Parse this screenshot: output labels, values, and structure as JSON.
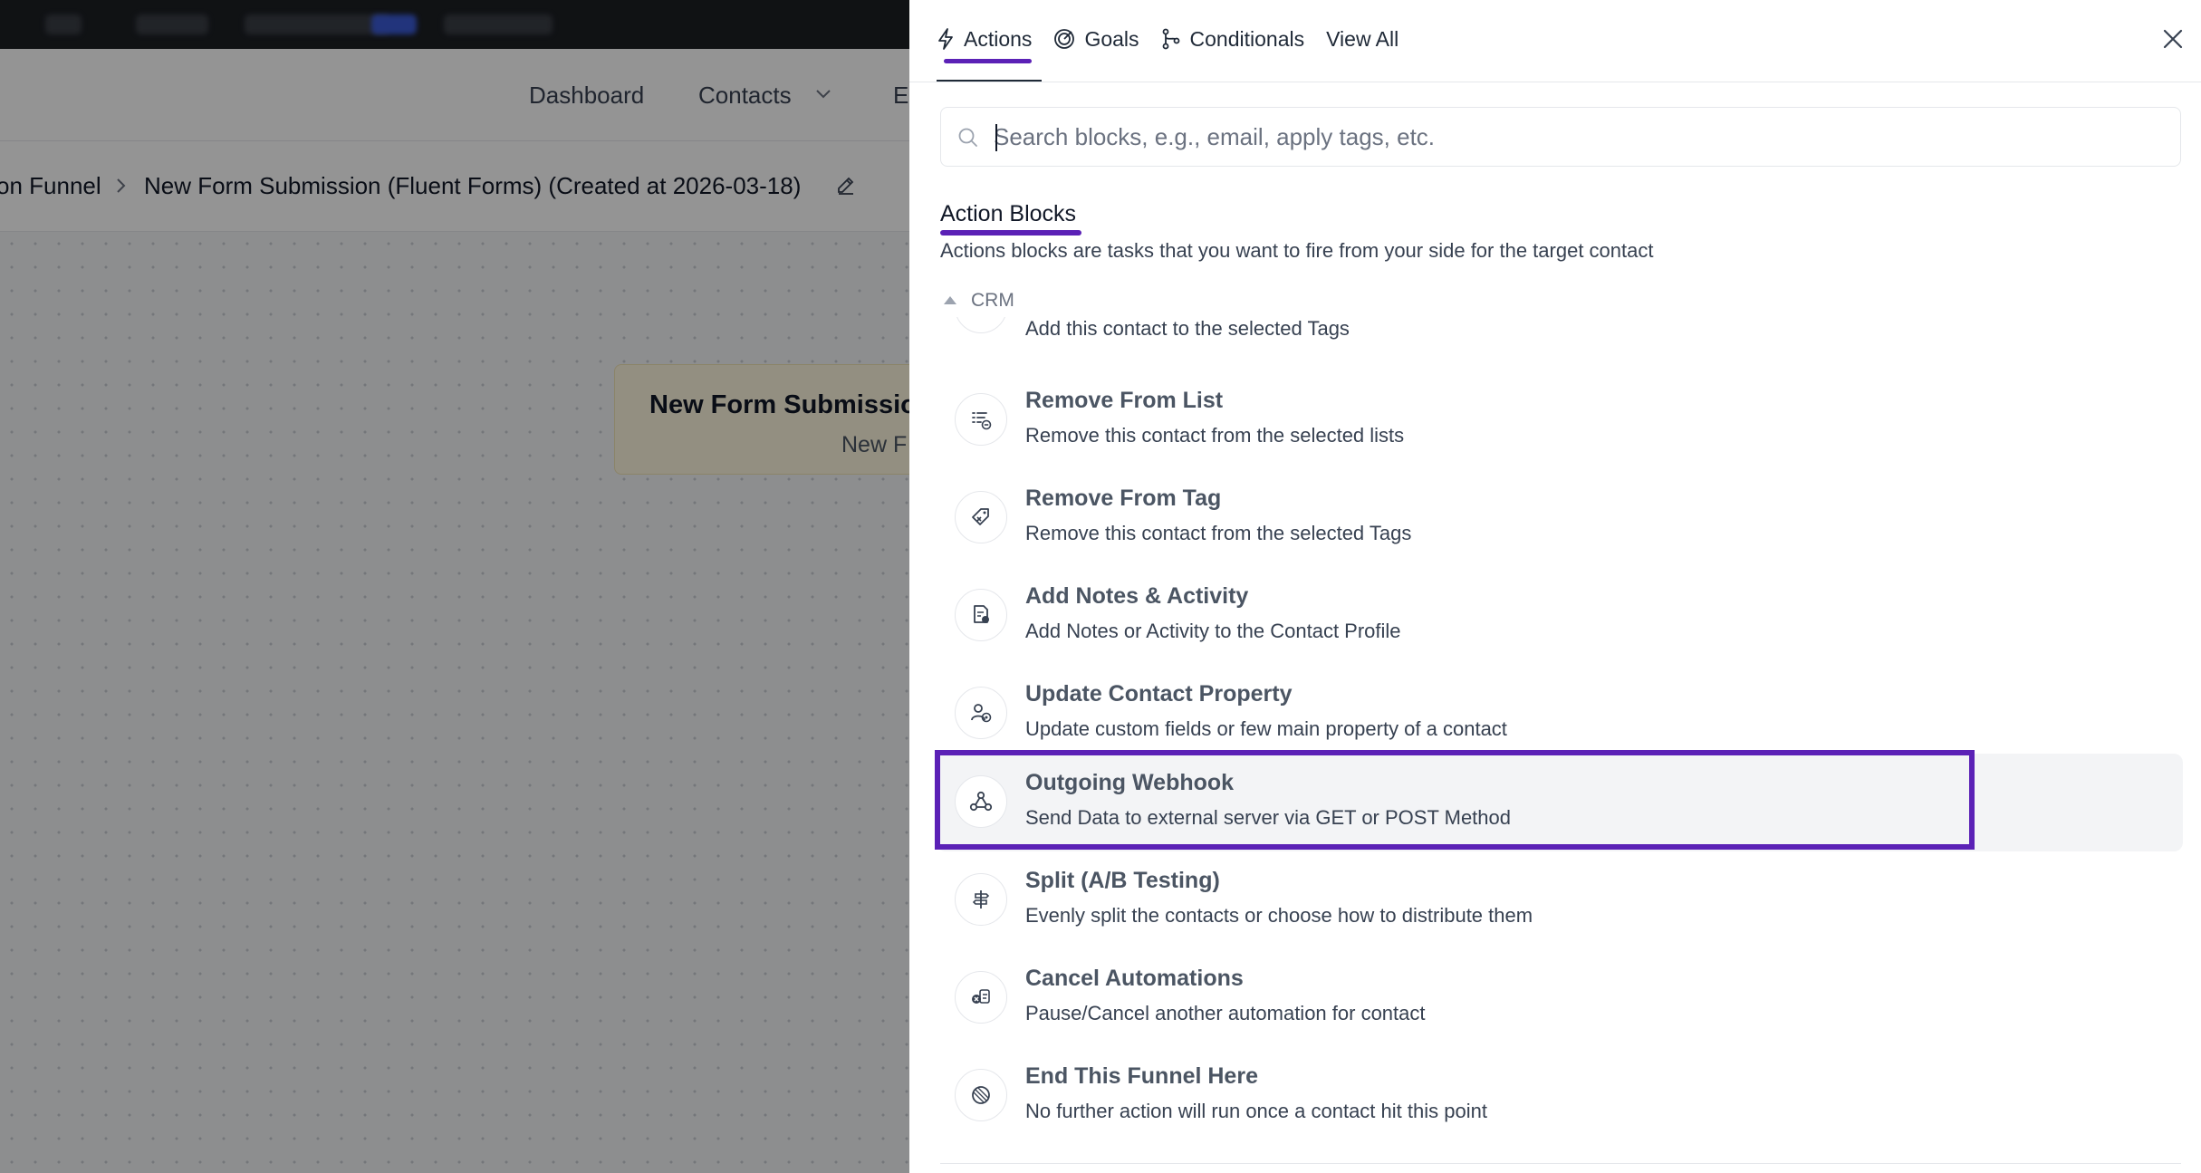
{
  "background": {
    "nav": {
      "dashboard": "Dashboard",
      "contacts": "Contacts",
      "truncated": "E"
    },
    "breadcrumb": {
      "parent": "on Funnel",
      "current": "New Form Submission (Fluent Forms) (Created at 2026-03-18)"
    },
    "trigger_card": {
      "title": "New Form Submissio",
      "subtitle": "New F"
    }
  },
  "drawer": {
    "tabs": [
      {
        "label": "Actions",
        "icon": "bolt-icon",
        "active": true
      },
      {
        "label": "Goals",
        "icon": "target-icon",
        "active": false
      },
      {
        "label": "Conditionals",
        "icon": "branch-icon",
        "active": false
      },
      {
        "label": "View All",
        "icon": "",
        "active": false
      }
    ],
    "search": {
      "placeholder": "Search blocks, e.g., email, apply tags, etc.",
      "value": ""
    },
    "section": {
      "title": "Action Blocks",
      "description": "Actions blocks are tasks that you want to fire from your side for the target contact"
    },
    "group": {
      "label": "CRM"
    },
    "partial_item": {
      "description": "Add this contact to the selected Tags"
    },
    "items": [
      {
        "title": "Remove From List",
        "description": "Remove this contact from the selected lists",
        "icon": "list-remove-icon"
      },
      {
        "title": "Remove From Tag",
        "description": "Remove this contact from the selected Tags",
        "icon": "tag-remove-icon"
      },
      {
        "title": "Add Notes & Activity",
        "description": "Add Notes or Activity to the Contact Profile",
        "icon": "note-icon"
      },
      {
        "title": "Update Contact Property",
        "description": "Update custom fields or few main property of a contact",
        "icon": "contact-property-icon"
      },
      {
        "title": "Outgoing Webhook",
        "description": "Send Data to external server via GET or POST Method",
        "icon": "webhook-icon",
        "highlighted": true
      },
      {
        "title": "Split (A/B Testing)",
        "description": "Evenly split the contacts or choose how to distribute them",
        "icon": "split-icon"
      },
      {
        "title": "Cancel Automations",
        "description": "Pause/Cancel another automation for contact",
        "icon": "cancel-automation-icon"
      },
      {
        "title": "End This Funnel Here",
        "description": "No further action will run once a contact hit this point",
        "icon": "end-funnel-icon"
      }
    ]
  },
  "colors": {
    "accent": "#5b21b6",
    "overlay": "rgba(0,0,0,0.42)",
    "row_highlight": "#f3f4f6"
  }
}
